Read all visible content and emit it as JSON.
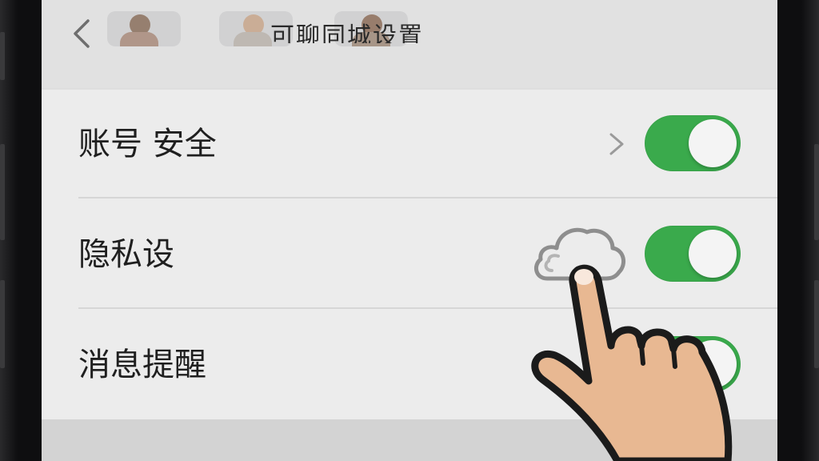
{
  "nav": {
    "title": "可聊同城设置",
    "back_icon": "chevron-left-icon"
  },
  "settings": [
    {
      "label": "账号 安全",
      "has_chevron": true,
      "toggle_on": true
    },
    {
      "label": "隐私设",
      "has_chevron": false,
      "toggle_on": true
    },
    {
      "label": "消息提醒",
      "has_chevron": false,
      "toggle_on": true
    }
  ],
  "overlay": {
    "cloud_icon": "cloud-outline-icon",
    "hand_icon": "pointing-hand-icon"
  },
  "colors": {
    "toggle_on": "#3aaa4c",
    "screen_bg": "#dedede",
    "card_bg": "#ececec",
    "hand_skin": "#e8b892"
  }
}
